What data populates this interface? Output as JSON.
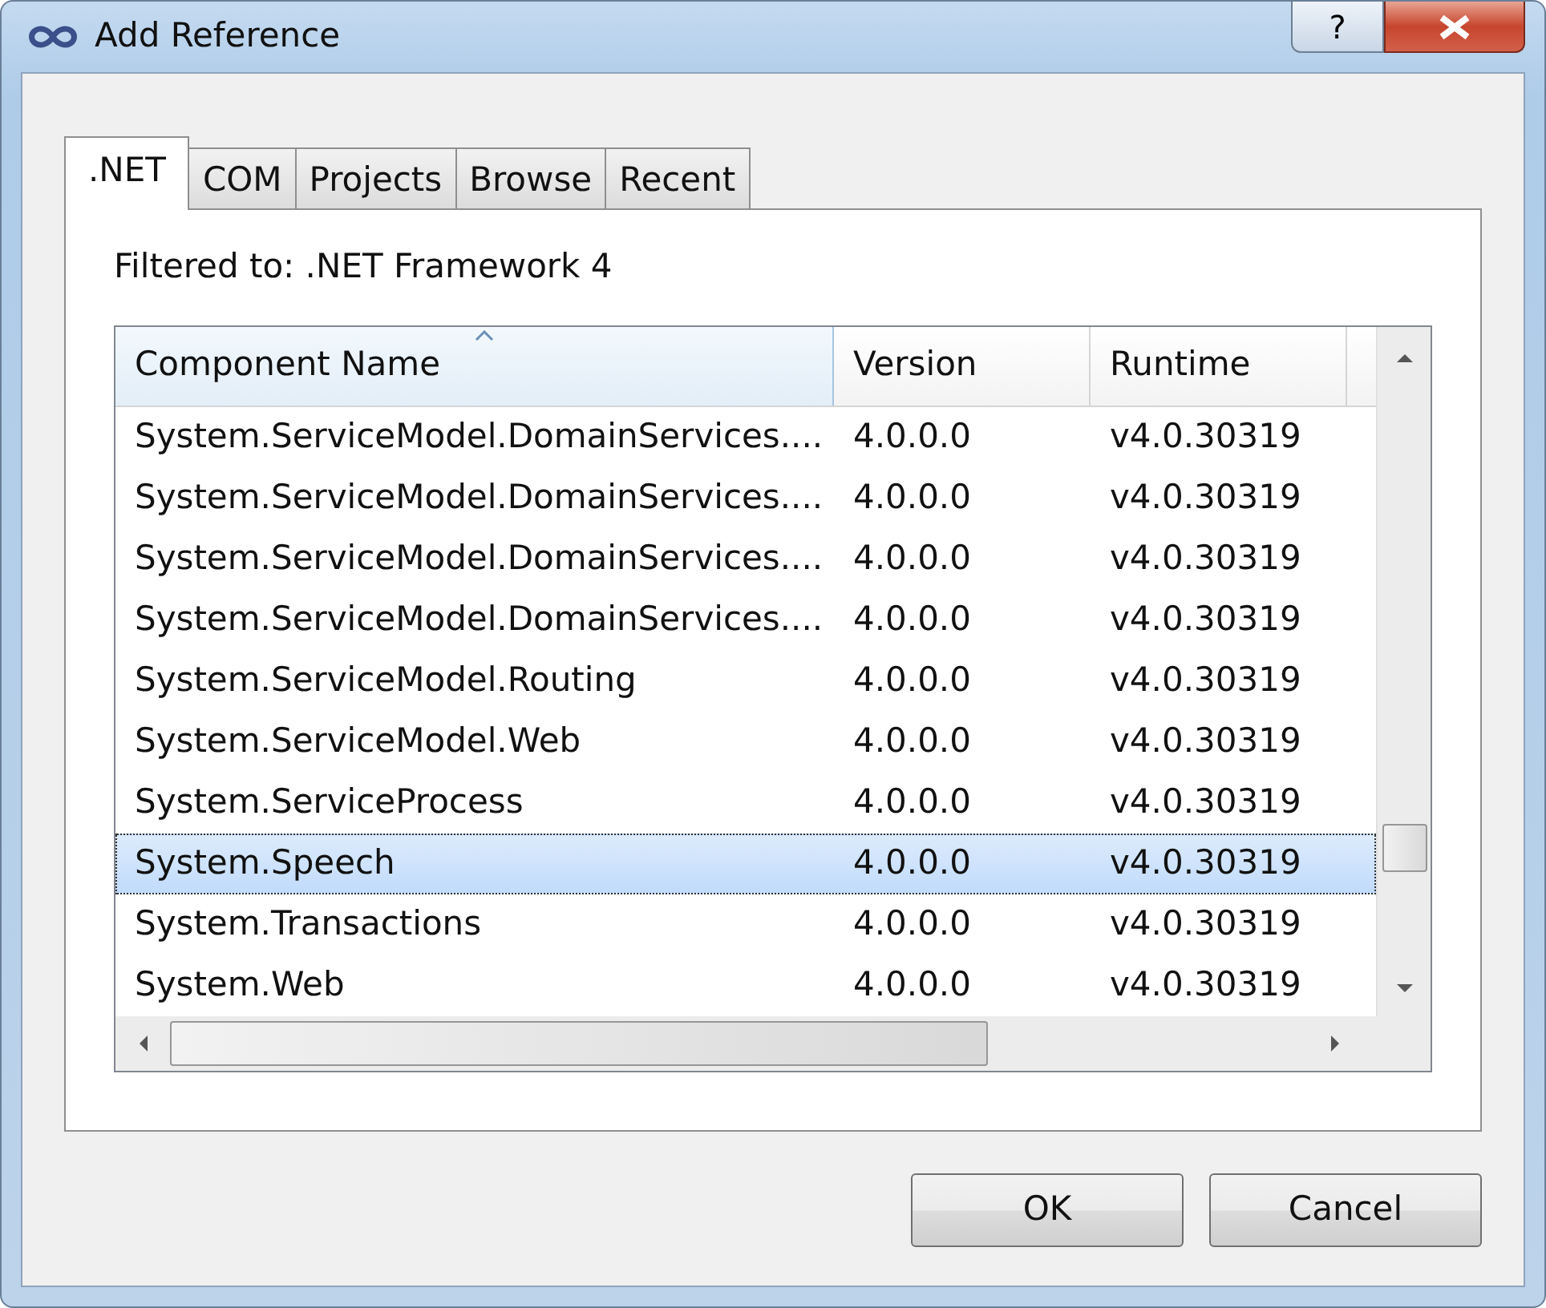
{
  "window": {
    "title": "Add Reference",
    "help_button": "?"
  },
  "tabs": [
    {
      "label": ".NET",
      "selected": true
    },
    {
      "label": "COM",
      "selected": false
    },
    {
      "label": "Projects",
      "selected": false
    },
    {
      "label": "Browse",
      "selected": false
    },
    {
      "label": "Recent",
      "selected": false
    }
  ],
  "filter_label": "Filtered to: .NET Framework 4",
  "table": {
    "columns": [
      {
        "label": "Component Name",
        "sorted": true
      },
      {
        "label": "Version",
        "sorted": false
      },
      {
        "label": "Runtime",
        "sorted": false
      }
    ],
    "rows": [
      {
        "cells": [
          "System.ServiceModel.DomainServices....",
          "4.0.0.0",
          "v4.0.30319"
        ],
        "selected": false
      },
      {
        "cells": [
          "System.ServiceModel.DomainServices....",
          "4.0.0.0",
          "v4.0.30319"
        ],
        "selected": false
      },
      {
        "cells": [
          "System.ServiceModel.DomainServices....",
          "4.0.0.0",
          "v4.0.30319"
        ],
        "selected": false
      },
      {
        "cells": [
          "System.ServiceModel.DomainServices....",
          "4.0.0.0",
          "v4.0.30319"
        ],
        "selected": false
      },
      {
        "cells": [
          "System.ServiceModel.Routing",
          "4.0.0.0",
          "v4.0.30319"
        ],
        "selected": false
      },
      {
        "cells": [
          "System.ServiceModel.Web",
          "4.0.0.0",
          "v4.0.30319"
        ],
        "selected": false
      },
      {
        "cells": [
          "System.ServiceProcess",
          "4.0.0.0",
          "v4.0.30319"
        ],
        "selected": false
      },
      {
        "cells": [
          "System.Speech",
          "4.0.0.0",
          "v4.0.30319"
        ],
        "selected": true
      },
      {
        "cells": [
          "System.Transactions",
          "4.0.0.0",
          "v4.0.30319"
        ],
        "selected": false
      },
      {
        "cells": [
          "System.Web",
          "4.0.0.0",
          "v4.0.30319"
        ],
        "selected": false
      }
    ]
  },
  "buttons": [
    "OK",
    "Cancel"
  ]
}
